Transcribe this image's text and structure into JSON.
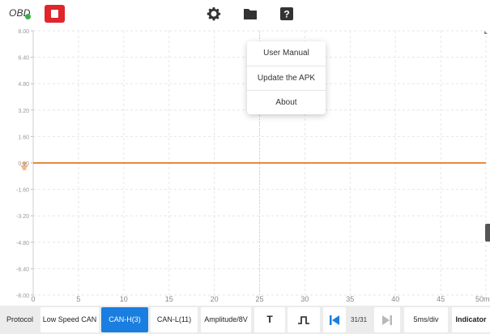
{
  "topbar": {
    "obd_label": "OBD",
    "stop_button": "stop",
    "icons": [
      "gear-icon",
      "folder-icon",
      "help-icon"
    ]
  },
  "scope": {
    "y_ticks": [
      "8.00",
      "6.40",
      "4.80",
      "3.20",
      "1.60",
      "0.00",
      "-1.60",
      "-3.20",
      "-4.80",
      "-6.40",
      "-8.00"
    ],
    "x_ticks": [
      "0",
      "5",
      "10",
      "15",
      "20",
      "25",
      "30",
      "35",
      "40",
      "45",
      "50ms"
    ],
    "trace_level": 0,
    "trace_color": "#e07b1f",
    "ground_marker_color": "#e07b1f"
  },
  "menu": {
    "items": [
      "User Manual",
      "Update the APK",
      "About"
    ]
  },
  "bottom": {
    "protocol_label": "Protocol",
    "protocol_value": "Low Speed CAN",
    "can_h": "CAN-H(3)",
    "can_l": "CAN-L(11)",
    "amplitude": "Amplitude/8V",
    "trigger_label": "T",
    "edge_label": "⊥",
    "page": "31/31",
    "timebase": "5ms/div",
    "indicator": "Indicator"
  },
  "colors": {
    "accent": "#1a7de0",
    "stop": "#e0252b",
    "trace": "#e07b1f"
  }
}
